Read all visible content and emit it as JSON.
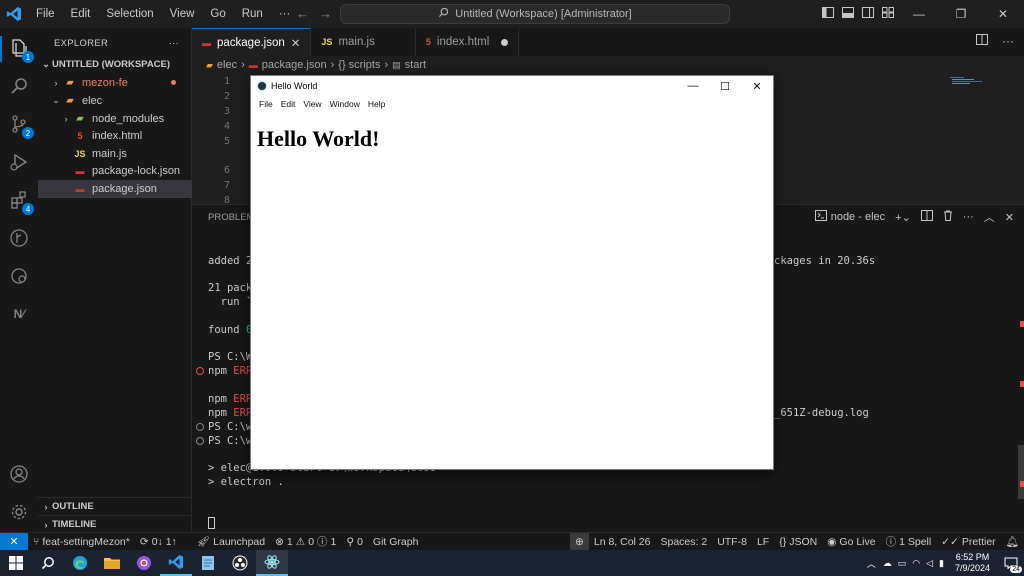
{
  "titlebar": {
    "menu": [
      "File",
      "Edit",
      "Selection",
      "View",
      "Go",
      "Run",
      "···"
    ],
    "command_center": "Untitled (Workspace) [Administrator]"
  },
  "activity_bar": {
    "badges": {
      "explorer": "1",
      "source_control": "2",
      "extensions": "4"
    }
  },
  "sidebar": {
    "title": "EXPLORER",
    "more": "···",
    "workspace": "UNTITLED (WORKSPACE)",
    "items": [
      {
        "label": "mezon-fe",
        "icon": "folder-icon",
        "color": "#e8845c"
      },
      {
        "label": "elec",
        "icon": "folder-open-icon",
        "color": "#cccccc"
      },
      {
        "label": "node_modules",
        "icon": "folder-icon",
        "color": "#cccccc"
      },
      {
        "label": "index.html",
        "icon": "html-icon",
        "color": "#cccccc"
      },
      {
        "label": "main.js",
        "icon": "js-icon",
        "color": "#cccccc"
      },
      {
        "label": "package-lock.json",
        "icon": "json-icon",
        "color": "#cccccc"
      },
      {
        "label": "package.json",
        "icon": "json-icon",
        "color": "#cccccc"
      }
    ],
    "outline": "OUTLINE",
    "timeline": "TIMELINE"
  },
  "tabs": [
    {
      "label": "package.json",
      "icon": "json-icon",
      "active": true
    },
    {
      "label": "main.js",
      "icon": "js-icon",
      "active": false
    },
    {
      "label": "index.html",
      "icon": "html-icon",
      "active": false
    }
  ],
  "breadcrumb": [
    "elec",
    "package.json",
    "{} scripts",
    "start"
  ],
  "editor": {
    "line_numbers": [
      "1",
      "2",
      "3",
      "4",
      "5",
      "6",
      "7",
      "8"
    ]
  },
  "panel": {
    "tab_label": "PROBLEMS",
    "terminal_name": "node - elec",
    "lines": [
      {
        "text": "added 2",
        "tail": "ckages in 20.36s"
      },
      {
        "text": "21 pack"
      },
      {
        "text": "  run `"
      },
      {
        "text": "found ",
        "tail_green": "0"
      },
      {
        "text": "PS C:\\W"
      },
      {
        "text": "npm ",
        "red": "ERR"
      },
      {
        "text": "npm ",
        "red": "ERR"
      },
      {
        "text": "npm ",
        "red": "ERR",
        "tail": "_651Z-debug.log"
      },
      {
        "text": "PS C:\\w"
      },
      {
        "text": "PS C:\\w"
      },
      {
        "text": "> elec@1.0.0 start C:\\Workspace\\elec"
      },
      {
        "text": "> electron ."
      }
    ]
  },
  "statusbar": {
    "remote": "✕",
    "branch": "feat-settingMezon*",
    "sync": "0↓ 1↑",
    "launchpad": "Launchpad",
    "errors": "1",
    "warnings": "0",
    "info": "1",
    "ports": "0",
    "git_graph": "Git Graph",
    "position": "Ln 8, Col 26",
    "spaces": "Spaces: 2",
    "encoding": "UTF-8",
    "eol": "LF",
    "language": "JSON",
    "go_live": "Go Live",
    "spell": "1 Spell",
    "prettier": "Prettier"
  },
  "taskbar": {
    "time": "6:52 PM",
    "date": "7/9/2024",
    "notifications": "24"
  },
  "electron_window": {
    "title": "Hello World",
    "menu": [
      "File",
      "Edit",
      "View",
      "Window",
      "Help"
    ],
    "heading": "Hello World!"
  }
}
